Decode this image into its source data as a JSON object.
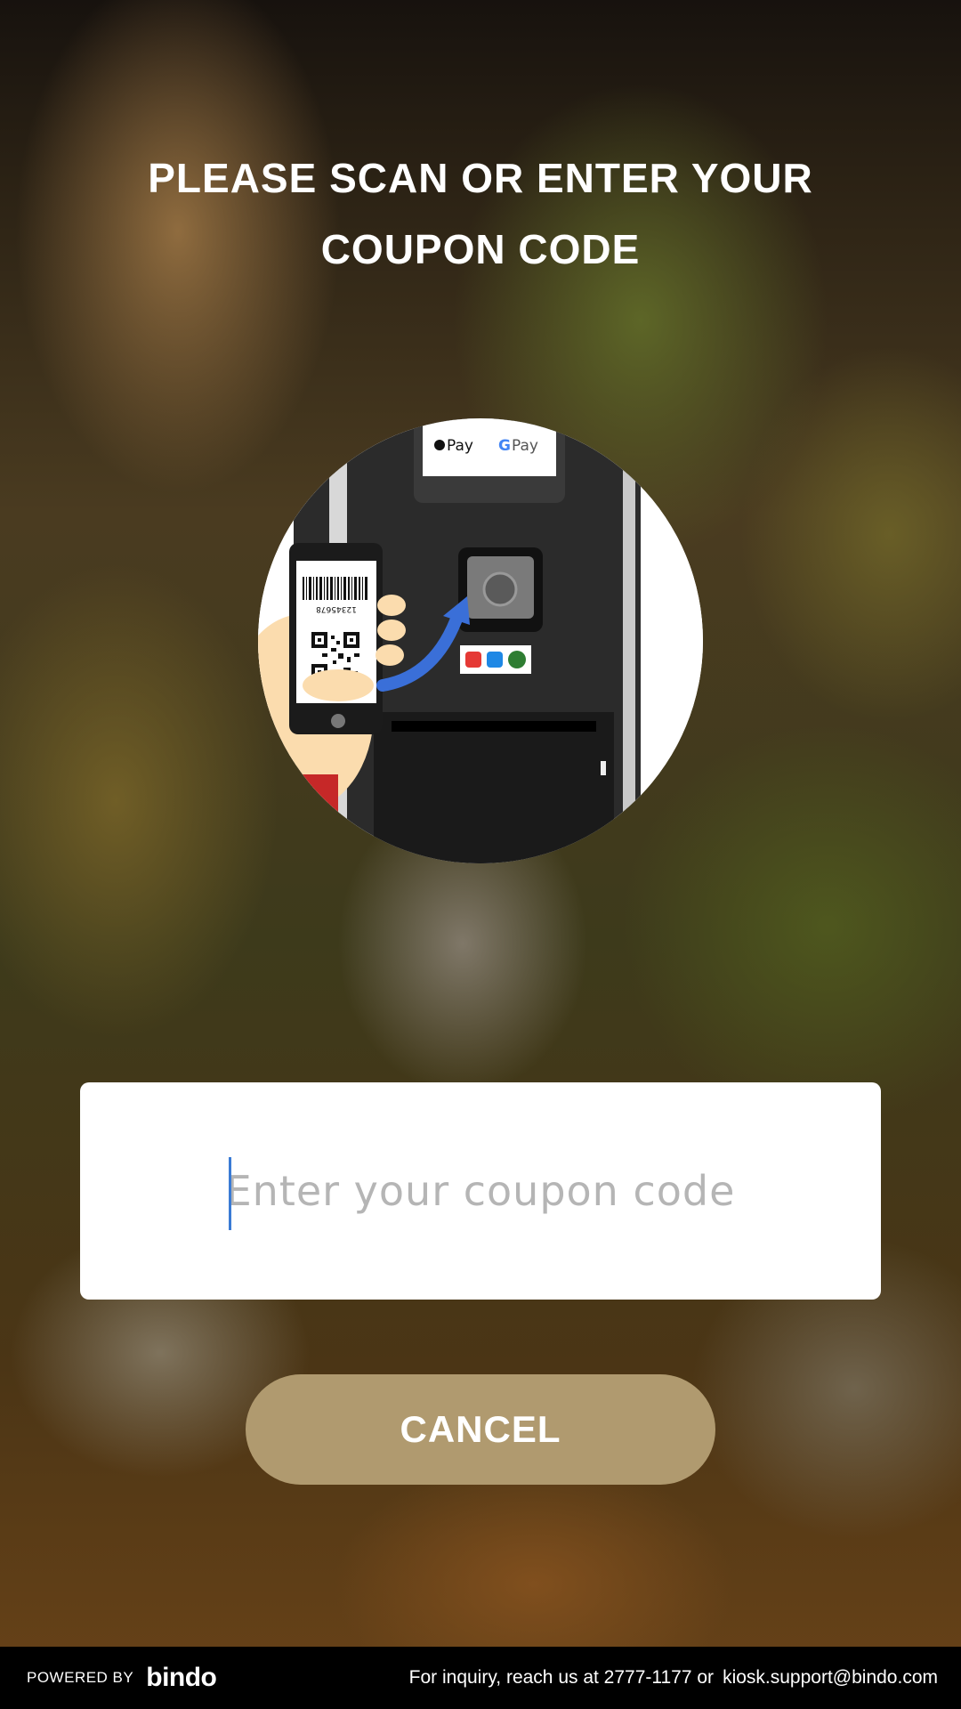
{
  "header": {
    "title_line1": "PLEASE SCAN OR ENTER YOUR",
    "title_line2": "COUPON CODE"
  },
  "illustration": {
    "icon": "scan-coupon-kiosk-illustration",
    "apple_pay_label": "Pay",
    "google_pay_label": "Pay",
    "barcode_number": "12345678"
  },
  "coupon": {
    "value": "",
    "placeholder": "Enter your coupon code"
  },
  "actions": {
    "cancel_label": "CANCEL"
  },
  "footer": {
    "powered_by": "POWERED BY",
    "brand": "bindo",
    "inquiry": "For inquiry, reach us at 2777-1177 or",
    "email": "kiosk.support@bindo.com"
  },
  "colors": {
    "accent": "#b09a6f",
    "caret": "#3a7bd5",
    "footer_bg": "#000000"
  }
}
